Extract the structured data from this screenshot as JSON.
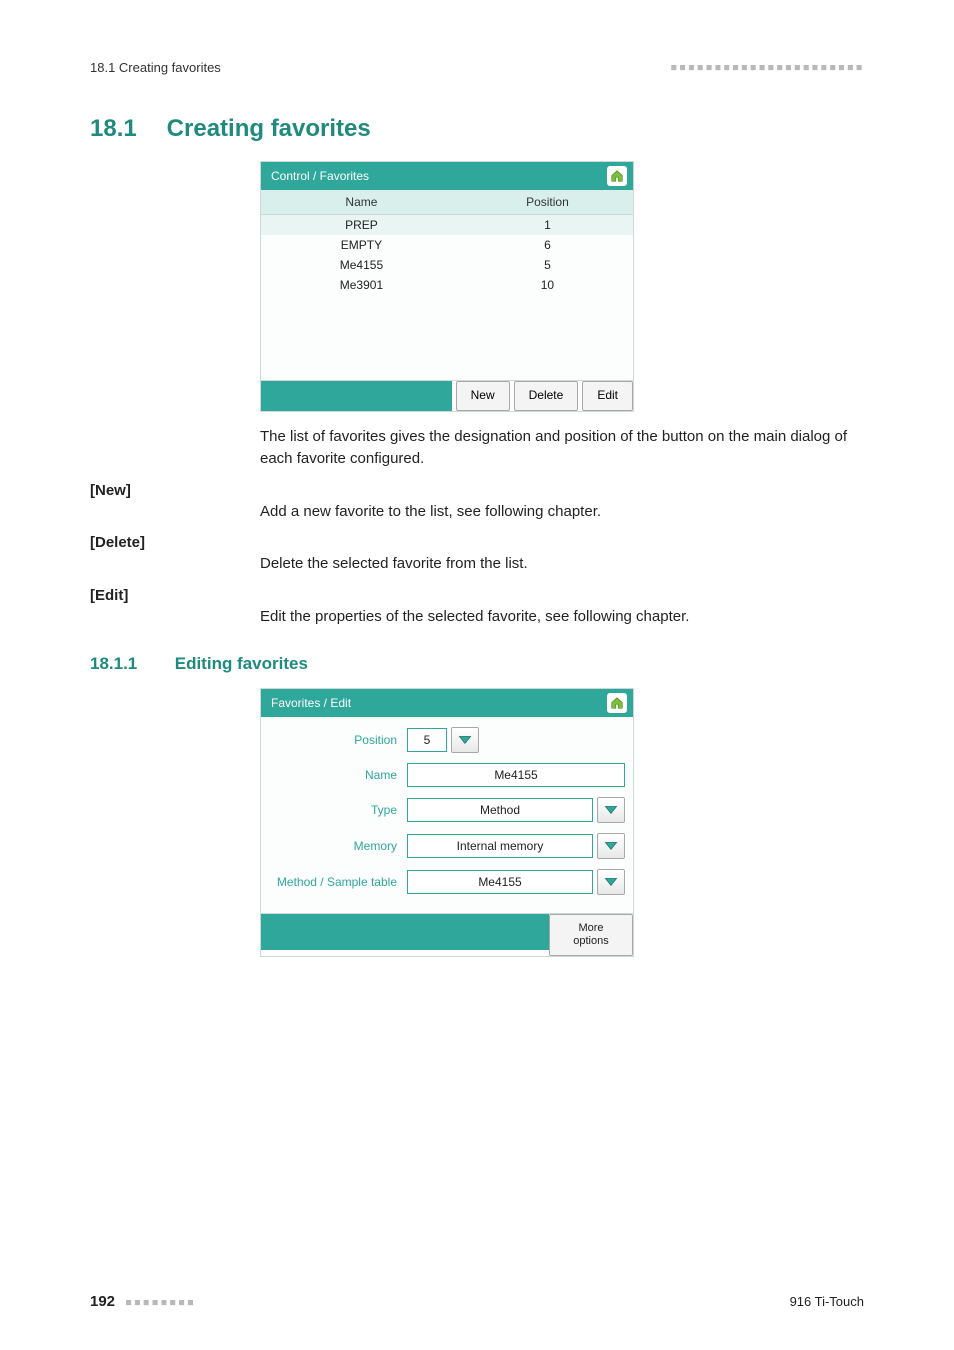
{
  "header": {
    "left": "18.1 Creating favorites",
    "right_dashes": "▪▪▪▪▪▪▪▪▪▪▪▪▪▪▪▪▪▪▪▪▪▪"
  },
  "section": {
    "number": "18.1",
    "title": "Creating favorites"
  },
  "favpanel": {
    "title": "Control / Favorites",
    "col_name": "Name",
    "col_position": "Position",
    "rows": [
      {
        "name": "PREP",
        "position": "1",
        "selected": true
      },
      {
        "name": "EMPTY",
        "position": "6",
        "selected": false
      },
      {
        "name": "Me4155",
        "position": "5",
        "selected": false
      },
      {
        "name": "Me3901",
        "position": "10",
        "selected": false
      }
    ],
    "buttons": {
      "new": "New",
      "delete": "Delete",
      "edit": "Edit"
    }
  },
  "intro_para": "The list of favorites gives the designation and position of the button on the main dialog of each favorite configured.",
  "defs": [
    {
      "term": "[New]",
      "desc": "Add a new favorite to the list, see following chapter."
    },
    {
      "term": "[Delete]",
      "desc": "Delete the selected favorite from the list."
    },
    {
      "term": "[Edit]",
      "desc": "Edit the properties of the selected favorite, see following chapter."
    }
  ],
  "subsection": {
    "number": "18.1.1",
    "title": "Editing favorites"
  },
  "editpanel": {
    "title": "Favorites / Edit",
    "fields": {
      "position_label": "Position",
      "position_value": "5",
      "name_label": "Name",
      "name_value": "Me4155",
      "type_label": "Type",
      "type_value": "Method",
      "memory_label": "Memory",
      "memory_value": "Internal memory",
      "method_label": "Method / Sample table",
      "method_value": "Me4155"
    },
    "more_options": "More\noptions"
  },
  "footer": {
    "page": "192",
    "dashes": "▪▪▪▪▪▪▪▪",
    "product": "916 Ti-Touch"
  }
}
